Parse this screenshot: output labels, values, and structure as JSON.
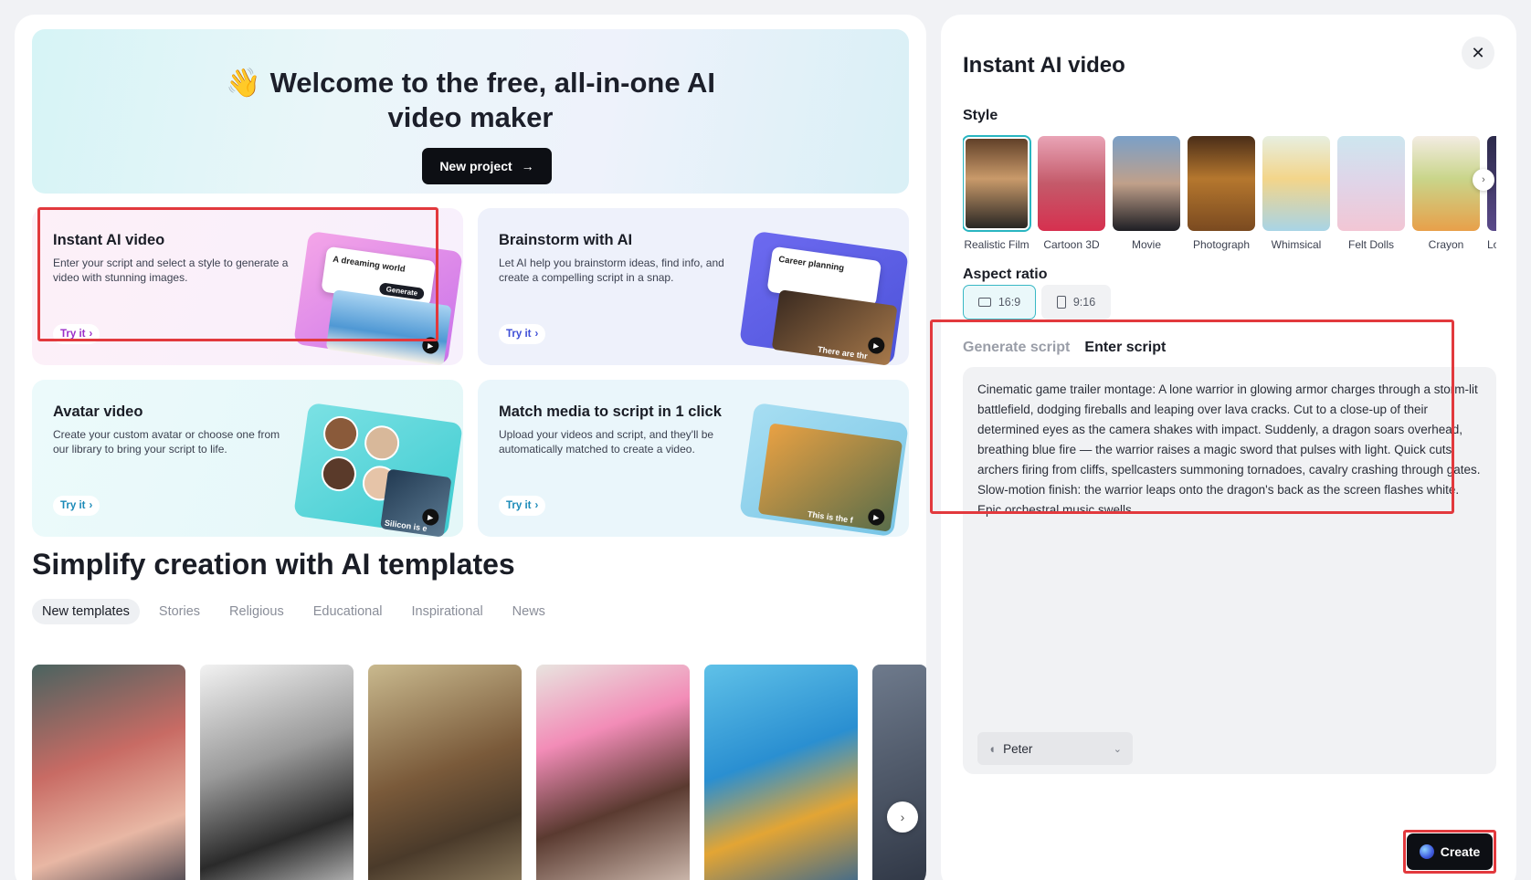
{
  "hero": {
    "emoji": "👋",
    "title": "Welcome to the free, all-in-one AI video maker",
    "new_project_label": "New project"
  },
  "feature_cards": [
    {
      "title": "Instant AI video",
      "description": "Enter your script and select a style to generate a video with stunning images.",
      "try_label": "Try it",
      "popup_text": "A dreaming world",
      "popup_button": "Generate"
    },
    {
      "title": "Brainstorm with AI",
      "description": "Let AI help you brainstorm ideas, find info, and create a compelling script in a snap.",
      "try_label": "Try it",
      "popup_text": "Career planning",
      "caption": "There are thr"
    },
    {
      "title": "Avatar video",
      "description": "Create your custom avatar or choose one from our library to bring your script to life.",
      "try_label": "Try it",
      "caption": "Silicon is e"
    },
    {
      "title": "Match media to script in 1 click",
      "description": "Upload your videos and script, and they'll be automatically matched to create a video.",
      "try_label": "Try it",
      "caption": "This is the f"
    }
  ],
  "templates": {
    "title": "Simplify creation with AI templates",
    "tabs": [
      "New templates",
      "Stories",
      "Religious",
      "Educational",
      "Inspirational",
      "News"
    ],
    "active_tab": "New templates"
  },
  "panel": {
    "title": "Instant AI video",
    "style_label": "Style",
    "styles": [
      "Realistic Film",
      "Cartoon 3D",
      "Movie",
      "Photograph",
      "Whimsical",
      "Felt Dolls",
      "Crayon",
      "Lo"
    ],
    "selected_style": "Realistic Film",
    "aspect_label": "Aspect ratio",
    "aspects": [
      "16:9",
      "9:16"
    ],
    "selected_aspect": "16:9",
    "script_tabs": [
      "Generate script",
      "Enter script"
    ],
    "active_script_tab": "Enter script",
    "script_text": "Cinematic game trailer montage: A lone warrior in glowing armor charges through a storm-lit battlefield, dodging fireballs and leaping over lava cracks. Cut to a close-up of their determined eyes as the camera shakes with impact. Suddenly, a dragon soars overhead, breathing blue fire — the warrior raises a magic sword that pulses with light. Quick cuts: archers firing from cliffs, spellcasters summoning tornadoes, cavalry crashing through gates. Slow-motion finish: the warrior leaps onto the dragon's back as the screen flashes white. Epic orchestral music swells.",
    "voice": "Peter",
    "create_label": "Create"
  },
  "colors": {
    "accent_teal": "#39b8c5",
    "highlight_red": "#e2393d",
    "button_dark": "#0d0f14"
  }
}
